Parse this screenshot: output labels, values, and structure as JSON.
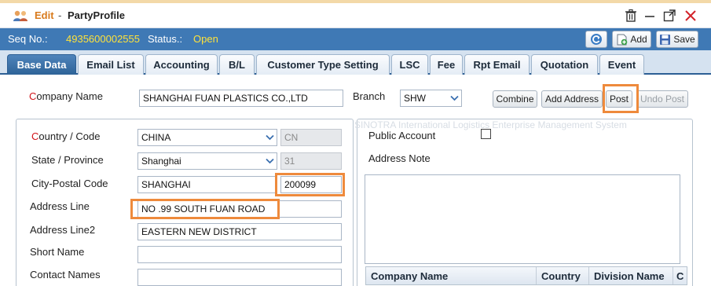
{
  "window": {
    "mode": "Edit",
    "separator": "-",
    "title": "PartyProfile"
  },
  "seqbar": {
    "seq_label": "Seq No.:",
    "seq_value": "4935600002555",
    "status_label": "Status.:",
    "status_value": "Open",
    "add_label": "Add",
    "save_label": "Save"
  },
  "tabs": [
    {
      "label": "Base Data"
    },
    {
      "label": "Email List"
    },
    {
      "label": "Accounting"
    },
    {
      "label": "B/L"
    },
    {
      "label": "Customer Type Setting"
    },
    {
      "label": "LSC"
    },
    {
      "label": "Fee"
    },
    {
      "label": "Rpt Email"
    },
    {
      "label": "Quotation"
    },
    {
      "label": "Event"
    }
  ],
  "header_form": {
    "company_name_label_first": "C",
    "company_name_label_rest": "ompany Name",
    "company_name_value": "SHANGHAI FUAN PLASTICS CO.,LTD",
    "branch_label": "Branch",
    "branch_value": "SHW",
    "combine_label": "Combine",
    "add_address_label": "Add Address",
    "post_label": "Post",
    "undo_post_label": "Undo Post"
  },
  "address_form": {
    "country_label_first": "C",
    "country_label_rest": "ountry / Code",
    "country_value": "CHINA",
    "country_code": "CN",
    "state_label": "State / Province",
    "state_value": "Shanghai",
    "state_code": "31",
    "city_label": "City-Postal Code",
    "city_value": "SHANGHAI",
    "postal_value": "200099",
    "address_line_label": "Address Line",
    "address_line_value": "NO .99 SOUTH FUAN ROAD",
    "address_line2_label": "Address Line2",
    "address_line2_value": "EASTERN NEW DISTRICT",
    "short_name_label": "Short Name",
    "short_name_value": "",
    "contact_names_label": "Contact Names",
    "contact_names_value": ""
  },
  "right_panel": {
    "watermark": "SINOTRA International Logistics Enterprise Management System",
    "public_account_label": "Public Account",
    "address_note_label": "Address Note",
    "grid_columns": [
      "Company Name",
      "Country",
      "Division Name",
      "C"
    ]
  },
  "colors": {
    "seqbar_bg": "#3f79b5",
    "seq_value": "#ffe23a",
    "tab_active": "#2e6398",
    "highlight": "#ee8a3c",
    "required": "#d2141a"
  }
}
